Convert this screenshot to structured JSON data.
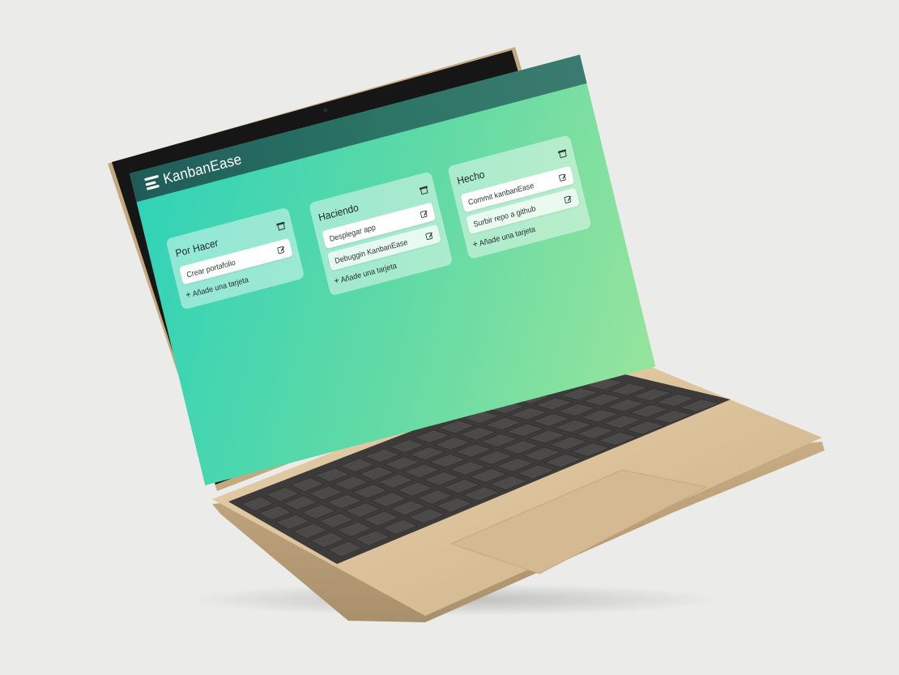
{
  "app": {
    "title": "KanbanEase"
  },
  "columns": [
    {
      "title": "Por Hacer",
      "cards": [
        "Crear portafolio"
      ],
      "add_label": "Añade una tarjeta"
    },
    {
      "title": "Haciendo",
      "cards": [
        "Desplegar app",
        "Debuggin KanbanEase"
      ],
      "add_label": "Añade una tarjeta"
    },
    {
      "title": "Hecho",
      "cards": [
        "Commit kanbanEase",
        "Surbir repo a github"
      ],
      "add_label": "Añade una tarjeta"
    }
  ],
  "colors": {
    "background": "#ebebea",
    "laptop_body": "#d9be96",
    "bezel": "#1c1c1c",
    "key": "#3a3a3a",
    "topbar": "#1f5c58",
    "gradient_start": "#2ed3b9",
    "gradient_end": "#96e49c"
  },
  "icons": {
    "logo": "kanban-logo-icon",
    "column_action": "archive-icon",
    "card_action": "edit-icon"
  }
}
